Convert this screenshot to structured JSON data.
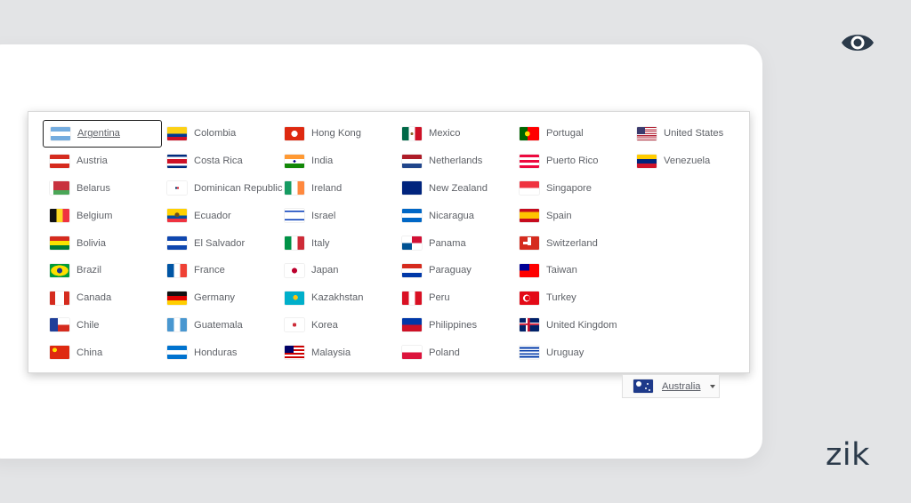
{
  "brand": {
    "logo_text": "zik",
    "logo_color": "#2b3a4a"
  },
  "icons": {
    "top_right": "eye-icon"
  },
  "selector": {
    "current_label": "Australia",
    "current_flag": "linear-gradient(#1e3a8a,#1e3a8a)",
    "open": true
  },
  "dropdown": {
    "selected": "Argentina",
    "countries": [
      {
        "name": "Argentina",
        "flag": "linear-gradient(#74acdf 0 33%,#fff 33% 67%,#74acdf 67%)"
      },
      {
        "name": "Austria",
        "flag": "linear-gradient(#d52b1e 0 33%,#fff 33% 67%,#d52b1e 67%)"
      },
      {
        "name": "Belarus",
        "flag": "linear-gradient(90deg,#fff 0 18%,transparent 18%),linear-gradient(#c8313e 0 66%,#4aa657 66%)"
      },
      {
        "name": "Belgium",
        "flag": "linear-gradient(90deg,#111 0 33%,#fdda24 33% 67%,#ef3340 67%)"
      },
      {
        "name": "Bolivia",
        "flag": "linear-gradient(#d52b1e 0 33%,#f9e300 33% 67%,#007934 67%)"
      },
      {
        "name": "Brazil",
        "flag": "radial-gradient(circle at 50% 50%,#1b3a8f 0 22%,transparent 23%),radial-gradient(ellipse 45% 40% at 50% 50%,#fedf00 0 98%,transparent 100%),linear-gradient(#009b3a,#009b3a)"
      },
      {
        "name": "Canada",
        "flag": "linear-gradient(90deg,#d52b1e 0 27%,#fff 27% 73%,#d52b1e 73%)"
      },
      {
        "name": "Chile",
        "flag": "linear-gradient(90deg,#1f3f99 0 40%,transparent 40%),linear-gradient(#fff 0 50%,#d52b1e 50%)"
      },
      {
        "name": "China",
        "flag": "radial-gradient(circle at 25% 32%,#ffde00 0 12%,transparent 13%),linear-gradient(#de2910,#de2910)"
      },
      {
        "name": "Colombia",
        "flag": "linear-gradient(#fcd116 0 50%,#003893 50% 75%,#ce1126 75%)"
      },
      {
        "name": "Costa Rica",
        "flag": "linear-gradient(#002b7f 0 17%,#fff 17% 33%,#ce1126 33% 67%,#fff 67% 83%,#002b7f 83%)"
      },
      {
        "name": "Dominican Republic",
        "flag": "linear-gradient(#fff 0 42%,transparent 42% 58%,#fff 58%),linear-gradient(90deg,#fff 0 42%,transparent 42% 58%,#fff 58%),linear-gradient(90deg,#002d62 0 50%,#ce1126 50%)"
      },
      {
        "name": "Ecuador",
        "flag": "radial-gradient(circle at 50% 45%,#6b4e1e 0 18%,transparent 19%),linear-gradient(#ffd100 0 50%,#034ea2 50% 75%,#ef3340 75%)"
      },
      {
        "name": "El Salvador",
        "flag": "linear-gradient(#0f47af 0 33%,#fff 33% 67%,#0f47af 67%)"
      },
      {
        "name": "France",
        "flag": "linear-gradient(90deg,#0055a4 0 33%,#fff 33% 67%,#ef4135 67%)"
      },
      {
        "name": "Germany",
        "flag": "linear-gradient(#111 0 33%,#dd0000 33% 67%,#ffce00 67%)"
      },
      {
        "name": "Guatemala",
        "flag": "linear-gradient(90deg,#4997d0 0 33%,#fff 33% 67%,#4997d0 67%)"
      },
      {
        "name": "Honduras",
        "flag": "linear-gradient(#0073cf 0 33%,#fff 33% 67%,#0073cf 67%)"
      },
      {
        "name": "Hong Kong",
        "flag": "radial-gradient(circle at 50% 50%,#fff 0 26%,transparent 27%),linear-gradient(#de2910,#de2910)"
      },
      {
        "name": "India",
        "flag": "radial-gradient(circle at 50% 50%,#000080 0 10%,transparent 11%),linear-gradient(#ff9933 0 33%,#fff 33% 67%,#138808 67%)"
      },
      {
        "name": "Ireland",
        "flag": "linear-gradient(90deg,#169b62 0 33%,#fff 33% 67%,#ff883e 67%)"
      },
      {
        "name": "Israel",
        "flag": "linear-gradient(#fff 0 12%,#0038b8 12% 24%,#fff 24% 76%,#0038b8 76% 88%,#fff 88%)"
      },
      {
        "name": "Italy",
        "flag": "linear-gradient(90deg,#009246 0 33%,#fff 33% 67%,#ce2b37 67%)"
      },
      {
        "name": "Japan",
        "flag": "radial-gradient(circle at 50% 50%,#bc002d 0 22%,transparent 23%),linear-gradient(#fff,#fff)"
      },
      {
        "name": "Kazakhstan",
        "flag": "radial-gradient(circle at 55% 45%,#fec50c 0 18%,transparent 19%),linear-gradient(#00afca,#00afca)"
      },
      {
        "name": "Korea",
        "flag": "radial-gradient(circle at 50% 50%,#cd2e3a 0 16%,transparent 17%),linear-gradient(#fff,#fff)"
      },
      {
        "name": "Malaysia",
        "flag": "linear-gradient(90deg,#010066 0 45%,transparent 45%) 0 0/100% 55% no-repeat,repeating-linear-gradient(#cc0001 0 2px,#fff 2px 4px)"
      },
      {
        "name": "Mexico",
        "flag": "radial-gradient(circle at 50% 50%,#8c6a2f 0 12%,transparent 13%),linear-gradient(90deg,#006847 0 33%,#fff 33% 67%,#ce1126 67%)"
      },
      {
        "name": "Netherlands",
        "flag": "linear-gradient(#ae1c28 0 33%,#fff 33% 67%,#21468b 67%)"
      },
      {
        "name": "New Zealand",
        "flag": "linear-gradient(#00247d,#00247d)"
      },
      {
        "name": "Nicaragua",
        "flag": "linear-gradient(#0067c6 0 33%,#fff 33% 67%,#0067c6 67%)"
      },
      {
        "name": "Panama",
        "flag": "linear-gradient(90deg,#fff 0 50%,#d21034 50%) 0 0/100% 50% no-repeat,linear-gradient(90deg,#005293 0 50%,#fff 50%)"
      },
      {
        "name": "Paraguay",
        "flag": "linear-gradient(#d52b1e 0 33%,#fff 33% 67%,#0038a8 67%)"
      },
      {
        "name": "Peru",
        "flag": "linear-gradient(90deg,#d91023 0 33%,#fff 33% 67%,#d91023 67%)"
      },
      {
        "name": "Philippines",
        "flag": "linear-gradient(#0038a8 0 50%,#ce1126 50%)"
      },
      {
        "name": "Poland",
        "flag": "linear-gradient(#fff 0 50%,#dc143c 50%)"
      },
      {
        "name": "Portugal",
        "flag": "radial-gradient(circle at 40% 50%,#ffe000 0 18%,transparent 19%),linear-gradient(90deg,#006600 0 40%,#ff0000 40%)"
      },
      {
        "name": "Puerto Rico",
        "flag": "repeating-linear-gradient(#ed0a3f 0 3px,#fff 3px 6px)"
      },
      {
        "name": "Singapore",
        "flag": "linear-gradient(#ef3340 0 50%,#fff 50%)"
      },
      {
        "name": "Spain",
        "flag": "linear-gradient(#c60b1e 0 25%,#ffc400 25% 75%,#c60b1e 75%)"
      },
      {
        "name": "Switzerland",
        "flag": "linear-gradient(90deg,transparent 0 40%,#fff 40% 60%,transparent 60%) 0 20%/100% 60% no-repeat,linear-gradient(transparent 0 40%,#fff 40% 60%,transparent 60%) 30% 0/40% 100% no-repeat,linear-gradient(#d52b1e,#d52b1e)"
      },
      {
        "name": "Taiwan",
        "flag": "linear-gradient(90deg,#000095 0 50%,transparent 50%) 0 0/100% 50% no-repeat,linear-gradient(#fe0000,#fe0000)"
      },
      {
        "name": "Turkey",
        "flag": "radial-gradient(circle at 40% 50%,#e30a17 0 18%,transparent 19%),radial-gradient(circle at 36% 50%,#fff 0 24%,transparent 25%),linear-gradient(#e30a17,#e30a17)"
      },
      {
        "name": "United Kingdom",
        "flag": "linear-gradient(#c8102e,#c8102e) 45% 0/12% 100% no-repeat,linear-gradient(#c8102e,#c8102e) 0 45%/100% 12% no-repeat,linear-gradient(#fff,#fff) 42% 0/20% 100% no-repeat,linear-gradient(#fff,#fff) 0 40%/100% 20% no-repeat,linear-gradient(#012169,#012169)"
      },
      {
        "name": "Uruguay",
        "flag": "repeating-linear-gradient(#fff 0 1.67px,#0038a8 1.67px 3.33px)"
      },
      {
        "name": "United States",
        "flag": "linear-gradient(#3c3b6e,#3c3b6e) 0 0/42% 54% no-repeat,repeating-linear-gradient(#b22234 0 1.15px,#fff 1.15px 2.3px)"
      },
      {
        "name": "Venezuela",
        "flag": "linear-gradient(#ffcc00 0 33%,#00247d 33% 67%,#cf142b 67%)"
      }
    ]
  }
}
